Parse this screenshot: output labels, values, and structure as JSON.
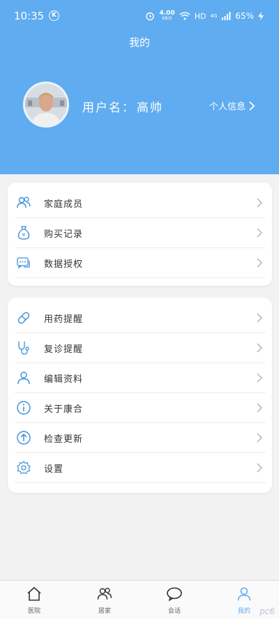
{
  "status": {
    "time": "10:35",
    "speed_value": "4.00",
    "speed_unit": "KB/S",
    "network": "HD",
    "signal": "4G",
    "battery": "65%"
  },
  "header": {
    "title": "我的",
    "username_label": "用户名：",
    "username": "高帅",
    "profile_link": "个人信息"
  },
  "card1": [
    {
      "label": "家庭成员",
      "icon": "family-icon"
    },
    {
      "label": "购买记录",
      "icon": "money-bag-icon"
    },
    {
      "label": "数据授权",
      "icon": "chat-bubble-icon"
    }
  ],
  "card2": [
    {
      "label": "用药提醒",
      "icon": "pill-icon"
    },
    {
      "label": "复诊提醒",
      "icon": "stethoscope-icon"
    },
    {
      "label": "编辑资料",
      "icon": "user-icon"
    },
    {
      "label": "关于康合",
      "icon": "info-icon"
    },
    {
      "label": "检查更新",
      "icon": "upload-arrow-icon"
    },
    {
      "label": "设置",
      "icon": "settings-gear-icon"
    }
  ],
  "tabs": [
    {
      "label": "医院",
      "icon": "home-icon"
    },
    {
      "label": "居家",
      "icon": "people-icon"
    },
    {
      "label": "会话",
      "icon": "chat-icon"
    },
    {
      "label": "我的",
      "icon": "person-icon"
    }
  ],
  "watermark": "pc6",
  "colors": {
    "accent": "#5facf0",
    "icon": "#3a8fd6"
  }
}
